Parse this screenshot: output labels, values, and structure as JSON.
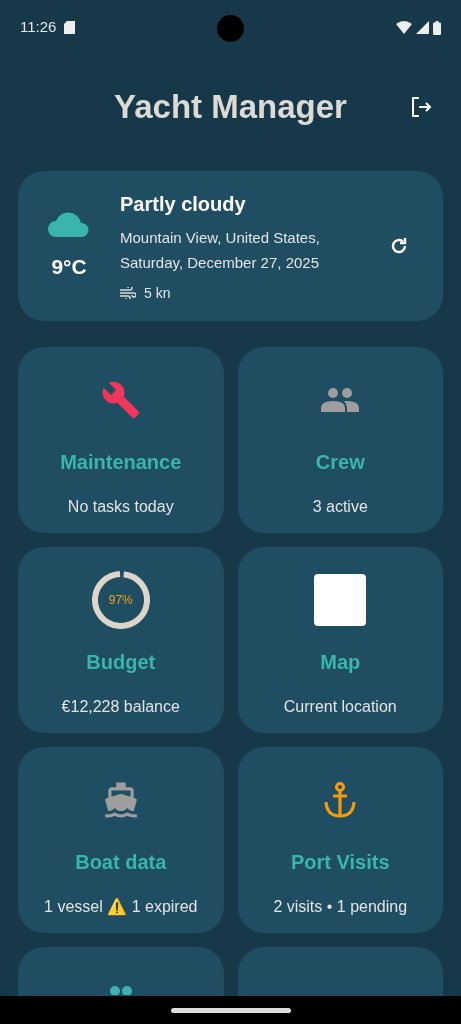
{
  "status_bar": {
    "time": "11:26"
  },
  "app_bar": {
    "title": "Yacht Manager"
  },
  "weather": {
    "condition": "Partly cloudy",
    "temperature": "9°C",
    "location": "Mountain View, United States,",
    "date": "Saturday, December 27, 2025",
    "wind": "5 kn"
  },
  "tiles": [
    {
      "kind": "wrench",
      "title": "Maintenance",
      "subtitle": "No tasks today"
    },
    {
      "kind": "crew",
      "title": "Crew",
      "subtitle": "3 active"
    },
    {
      "kind": "gauge",
      "title": "Budget",
      "subtitle": "€12,228 balance",
      "gauge_label": "97%",
      "level": 0.97
    },
    {
      "kind": "map",
      "title": "Map",
      "subtitle": "Current location"
    },
    {
      "kind": "boat",
      "title": "Boat data",
      "subtitle": "1 vessel ⚠️ 1 expired"
    },
    {
      "kind": "anchor",
      "title": "Port Visits",
      "subtitle": "2 visits • 1 pending"
    },
    {
      "kind": "partial-crew"
    },
    {
      "kind": "partial-empty"
    }
  ]
}
